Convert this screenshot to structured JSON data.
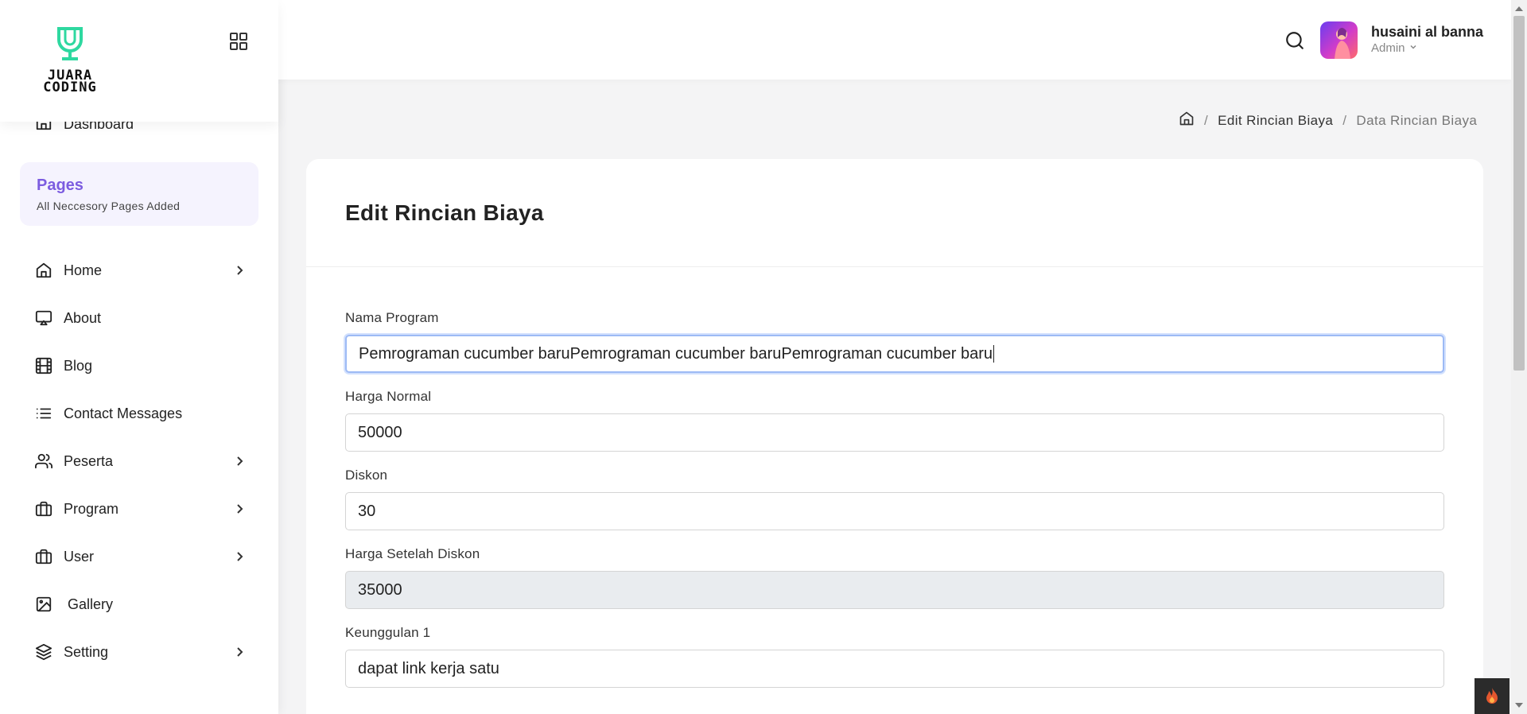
{
  "brand": {
    "logo_text": "JUARA CODING",
    "grid_icon": "grid-icon"
  },
  "sidebar": {
    "dashboard": {
      "label": "Dashboard",
      "icon": "home-icon"
    },
    "pages_card": {
      "title": "Pages",
      "subtitle": "All Neccesory Pages Added"
    },
    "items": [
      {
        "label": "Home",
        "icon": "home-icon",
        "has_submenu": true
      },
      {
        "label": "About",
        "icon": "monitor-icon",
        "has_submenu": false
      },
      {
        "label": "Blog",
        "icon": "film-icon",
        "has_submenu": false
      },
      {
        "label": "Contact Messages",
        "icon": "list-icon",
        "has_submenu": false
      },
      {
        "label": "Peserta",
        "icon": "users-icon",
        "has_submenu": true
      },
      {
        "label": "Program",
        "icon": "briefcase-icon",
        "has_submenu": true
      },
      {
        "label": "User",
        "icon": "briefcase-icon",
        "has_submenu": true
      },
      {
        "label": "Gallery",
        "icon": "image-icon",
        "has_submenu": false
      },
      {
        "label": "Setting",
        "icon": "layers-icon",
        "has_submenu": true
      }
    ]
  },
  "header": {
    "user_name": "husaini al banna",
    "user_role": "Admin"
  },
  "breadcrumb": {
    "link": "Edit Rincian Biaya",
    "current": "Data Rincian Biaya"
  },
  "card": {
    "title": "Edit Rincian Biaya",
    "fields": [
      {
        "label": "Nama Program",
        "value": "Pemrograman cucumber baruPemrograman cucumber baruPemrograman cucumber baru",
        "focused": true,
        "readonly": false
      },
      {
        "label": "Harga Normal",
        "value": "50000",
        "focused": false,
        "readonly": false
      },
      {
        "label": "Diskon",
        "value": "30",
        "focused": false,
        "readonly": false
      },
      {
        "label": "Harga Setelah Diskon",
        "value": "35000",
        "focused": false,
        "readonly": true
      },
      {
        "label": "Keunggulan 1",
        "value": "dapat link kerja satu",
        "focused": false,
        "readonly": false
      }
    ]
  },
  "colors": {
    "accent": "#7c5ce0",
    "logo_green": "#2ed8a0",
    "focus_border": "#9dbaf5",
    "readonly_bg": "#e9ecef"
  }
}
